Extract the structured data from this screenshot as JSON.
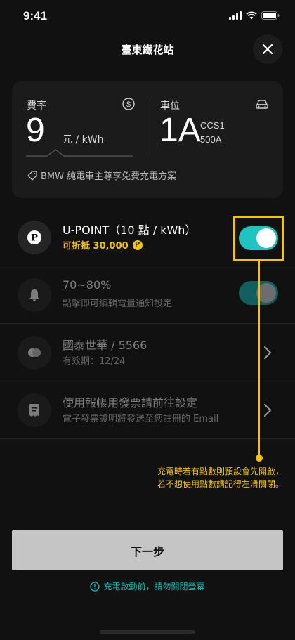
{
  "status_bar": {
    "time": "9:41"
  },
  "header": {
    "title": "臺東鐵花站"
  },
  "info_card": {
    "rate_label": "費率",
    "rate_value": "9",
    "rate_unit": "元 / kWh",
    "spot_label": "車位",
    "spot_value": "1A",
    "connector_type": "CCS1",
    "power_rating": "500A",
    "promo": "BMW 純電車主尊享免費充電方案"
  },
  "rows": [
    {
      "title": "U-POINT（10 點 / kWh）",
      "subtitle": "可折抵 30,000",
      "toggle_on": true,
      "coin_symbol": "P"
    },
    {
      "title": "70~80%",
      "subtitle": "點擊即可編輯電量通知設定",
      "toggle_on": true
    },
    {
      "title": "國泰世華 / 5566",
      "subtitle": "有效期：12/24"
    },
    {
      "title": "使用報帳用發票請前往設定",
      "subtitle": "電子發票證明將發送至您註冊的 Email"
    }
  ],
  "callout": {
    "line1": "充電時若有點數則預設會先開啟，",
    "line2": "若不想使用點數請記得左滑關閉。"
  },
  "next_button": "下一步",
  "warning": "充電啟動前，請勿關閉螢幕",
  "colors": {
    "accent_teal": "#21c3c0",
    "highlight_yellow": "#f5c018",
    "background": "#111111",
    "card": "#1b1b1b"
  },
  "icons": {
    "close": "close-icon",
    "rate": "dollar-icon",
    "spot": "car-icon",
    "promo": "tag-icon",
    "points": "p-coin-icon",
    "notification": "bell-icon",
    "card": "credit-card-icon",
    "invoice": "receipt-icon",
    "chevron": "chevron-right-icon",
    "warning": "info-circle-icon"
  }
}
